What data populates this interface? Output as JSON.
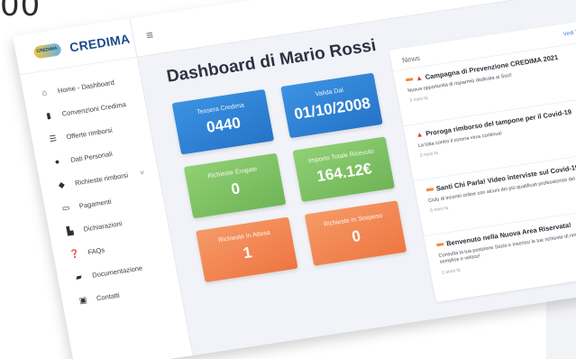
{
  "corner_text": "00",
  "app": {
    "logo_badge": "CREDIMA",
    "logo_text": "CREDIMA"
  },
  "sidebar": {
    "items": [
      {
        "label": "Home - Dashboard",
        "icon": "home-icon"
      },
      {
        "label": "Convenzioni Credima",
        "icon": "bookmark-icon"
      },
      {
        "label": "Offerte rimborsi",
        "icon": "list-icon"
      },
      {
        "label": "Dati Personali",
        "icon": "user-icon"
      },
      {
        "label": "Richieste rimborsi",
        "icon": "tag-icon",
        "chevron": "v"
      },
      {
        "label": "Pagamenti",
        "icon": "card-icon"
      },
      {
        "label": "Dichiarazioni",
        "icon": "document-icon"
      },
      {
        "label": "FAQs",
        "icon": "question-icon"
      },
      {
        "label": "Documentazione",
        "icon": "folder-icon"
      },
      {
        "label": "Contatti",
        "icon": "contact-icon"
      }
    ]
  },
  "topbar": {
    "menu_icon": "≡"
  },
  "dashboard": {
    "title": "Dashboard di Mario Rossi",
    "cards": [
      {
        "label": "Tessera Credima",
        "value": "0440",
        "color": "#2f86d8"
      },
      {
        "label": "Valida Dal",
        "value": "01/10/2008",
        "color": "#2f86d8"
      },
      {
        "label": "Richieste Erogate",
        "value": "0",
        "color": "#7cc262"
      },
      {
        "label": "Importo Totale Ricevuto",
        "value": "164.12€",
        "color": "#7cc262"
      },
      {
        "label": "Richieste In Attesa",
        "value": "1",
        "color": "#f08450"
      },
      {
        "label": "Richieste In Sospeso",
        "value": "0",
        "color": "#f08450"
      }
    ]
  },
  "news": {
    "title": "News",
    "view_all": "Vedi Tutte",
    "items": [
      {
        "title": "Campagna di Prevenzione CREDIMA 2021",
        "text": "Nuova opportunità di risparmio dedicata ai Soci!",
        "time": "3 mesi fa",
        "warning": true
      },
      {
        "title": "Proroga rimborso del tampone per il Covid-19",
        "text": "La lotta contro il corona virus continua!",
        "time": "3 mesi fa",
        "warning": true
      },
      {
        "title": "Santi Chi Parla! Video interviste sul Covid-19",
        "text": "Ciclo di incontri online con alcuni dei più qualificati professionisti del nostro territorio",
        "time": "5 mesi fa",
        "warning": false
      },
      {
        "title": "Benvenuto nella Nuova Area Riservata!",
        "text": "Consulta la tua posizione Socio e inserisci le tue richieste di rimborso in modo semplice e veloce!",
        "time": "1 anno fa",
        "warning": false
      }
    ]
  }
}
